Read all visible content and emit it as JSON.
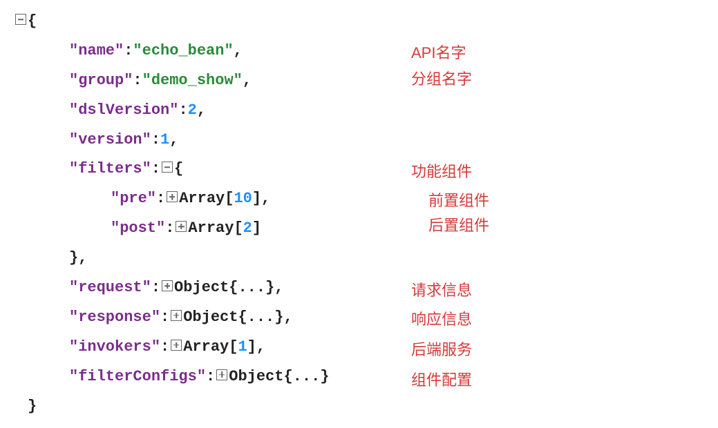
{
  "json": {
    "keys": {
      "name": "\"name\"",
      "group": "\"group\"",
      "dslVersion": "\"dslVersion\"",
      "version": "\"version\"",
      "filters": "\"filters\"",
      "pre": "\"pre\"",
      "post": "\"post\"",
      "request": "\"request\"",
      "response": "\"response\"",
      "invokers": "\"invokers\"",
      "filterConfigs": "\"filterConfigs\""
    },
    "values": {
      "name": "\"echo_bean\"",
      "group": "\"demo_show\"",
      "dslVersion": "2",
      "version": "1",
      "pre_count": "10",
      "post_count": "2",
      "invokers_count": "1"
    },
    "labels": {
      "array": "Array",
      "object": "Object",
      "obj_ellipsis": "{...}"
    }
  },
  "annotations": {
    "api_name": "API名字",
    "group_name": "分组名字",
    "func_comp": "功能组件",
    "pre_comp": "前置组件",
    "post_comp": "后置组件",
    "request_info": "请求信息",
    "response_info": "响应信息",
    "backend_service": "后端服务",
    "comp_config": "组件配置"
  }
}
